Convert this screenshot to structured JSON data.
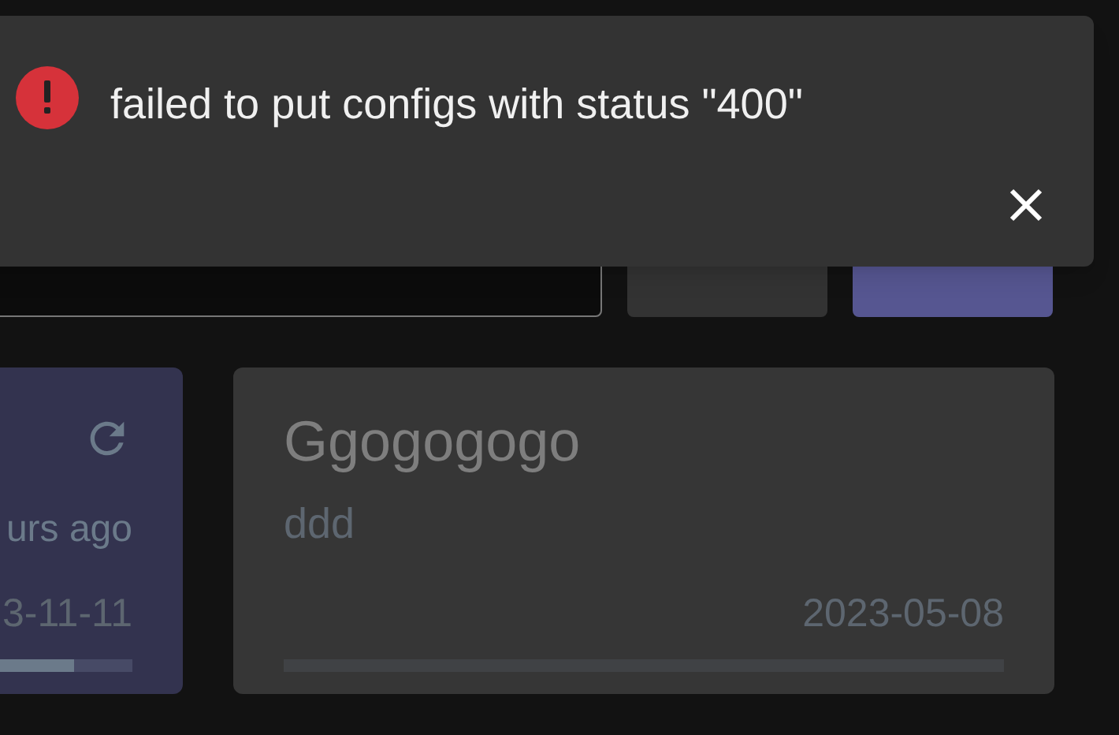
{
  "toast": {
    "kind": "error",
    "message": "failed to put configs with status \"400\""
  },
  "toolbar": {
    "buttons": [
      {
        "kind": "secondary"
      },
      {
        "kind": "primary"
      }
    ]
  },
  "cards": [
    {
      "selected": true,
      "updated": "urs ago",
      "date": "3-11-11",
      "level": 0.92
    },
    {
      "selected": false,
      "title": "Ggogogogo",
      "description": "ddd",
      "date": "2023-05-08",
      "level": 0
    }
  ]
}
